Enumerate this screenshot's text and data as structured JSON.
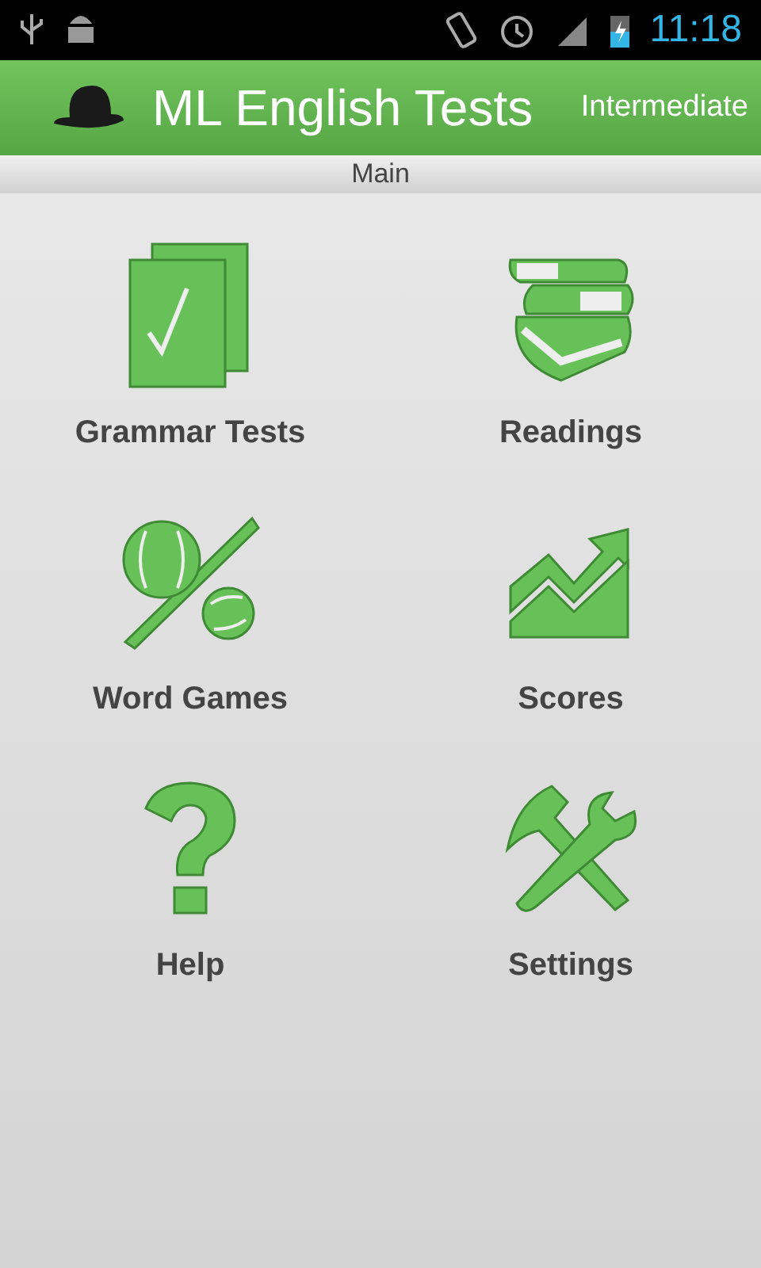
{
  "status_bar": {
    "time": "11:18"
  },
  "header": {
    "title": "ML English Tests",
    "level": "Intermediate"
  },
  "subheader": {
    "title": "Main"
  },
  "menu": [
    {
      "kind": "tests",
      "label": "Grammar Tests"
    },
    {
      "kind": "books",
      "label": "Readings"
    },
    {
      "kind": "games",
      "label": "Word Games"
    },
    {
      "kind": "scores",
      "label": "Scores"
    },
    {
      "kind": "help",
      "label": "Help"
    },
    {
      "kind": "settings",
      "label": "Settings"
    }
  ]
}
